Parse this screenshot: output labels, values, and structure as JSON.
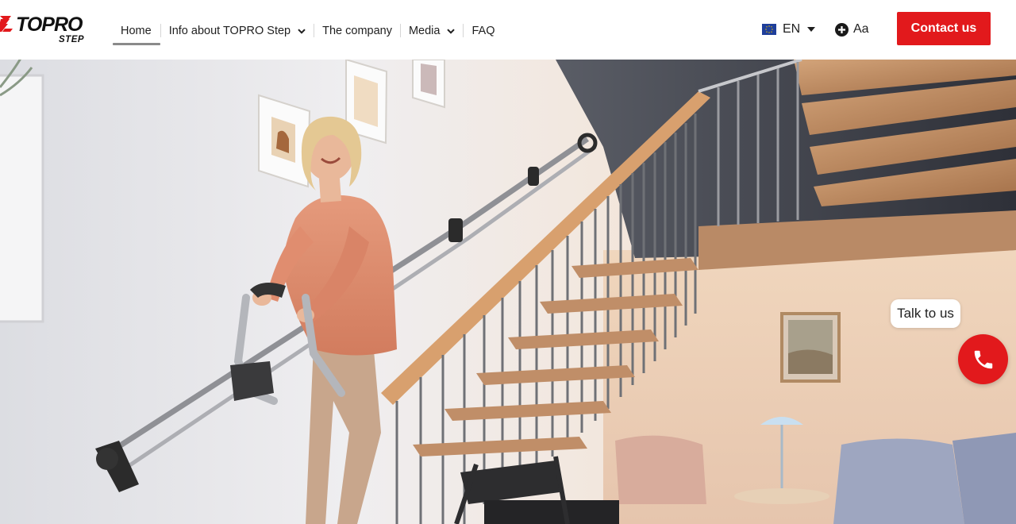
{
  "brand": {
    "logo_text": "TOPRO",
    "logo_sub": "STEP",
    "accent": "#e2191c"
  },
  "nav": {
    "items": [
      {
        "label": "Home",
        "active": true,
        "has_dropdown": false
      },
      {
        "label": "Info about TOPRO Step",
        "active": false,
        "has_dropdown": true
      },
      {
        "label": "The company",
        "active": false,
        "has_dropdown": false
      },
      {
        "label": "Media",
        "active": false,
        "has_dropdown": true
      },
      {
        "label": "FAQ",
        "active": false,
        "has_dropdown": false
      }
    ]
  },
  "language": {
    "code": "EN",
    "flag_icon": "eu-flag-icon",
    "dropdown_icon": "caret-down-icon"
  },
  "text_size": {
    "label": "Aa",
    "icon": "plus-circle-icon"
  },
  "contact": {
    "label": "Contact us"
  },
  "hero": {
    "image": "woman-climbing-stairs-with-topro-step-rail-photo"
  },
  "chat": {
    "bubble_label": "Talk to us",
    "call_icon": "phone-icon"
  }
}
